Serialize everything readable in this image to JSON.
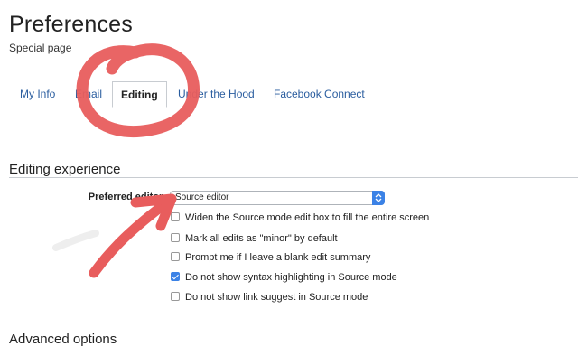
{
  "header": {
    "title": "Preferences",
    "subtitle": "Special page"
  },
  "tabs": [
    {
      "label": "My Info",
      "active": false
    },
    {
      "label": "Email",
      "active": false
    },
    {
      "label": "Editing",
      "active": true
    },
    {
      "label": "Under the Hood",
      "active": false
    },
    {
      "label": "Facebook Connect",
      "active": false
    }
  ],
  "editing_experience": {
    "heading": "Editing experience",
    "preferred_editor_label": "Preferred editor:",
    "preferred_editor_value": "Source editor",
    "options": [
      {
        "label": "Widen the Source mode edit box to fill the entire screen",
        "checked": false
      },
      {
        "label": "Mark all edits as \"minor\" by default",
        "checked": false
      },
      {
        "label": "Prompt me if I leave a blank edit summary",
        "checked": false
      },
      {
        "label": "Do not show syntax highlighting in Source mode",
        "checked": true
      },
      {
        "label": "Do not show link suggest in Source mode",
        "checked": false
      }
    ]
  },
  "advanced": {
    "heading": "Advanced options"
  },
  "colors": {
    "link": "#2a5d9f",
    "accent": "#3b82e6",
    "annotation": "#e85d5d"
  }
}
